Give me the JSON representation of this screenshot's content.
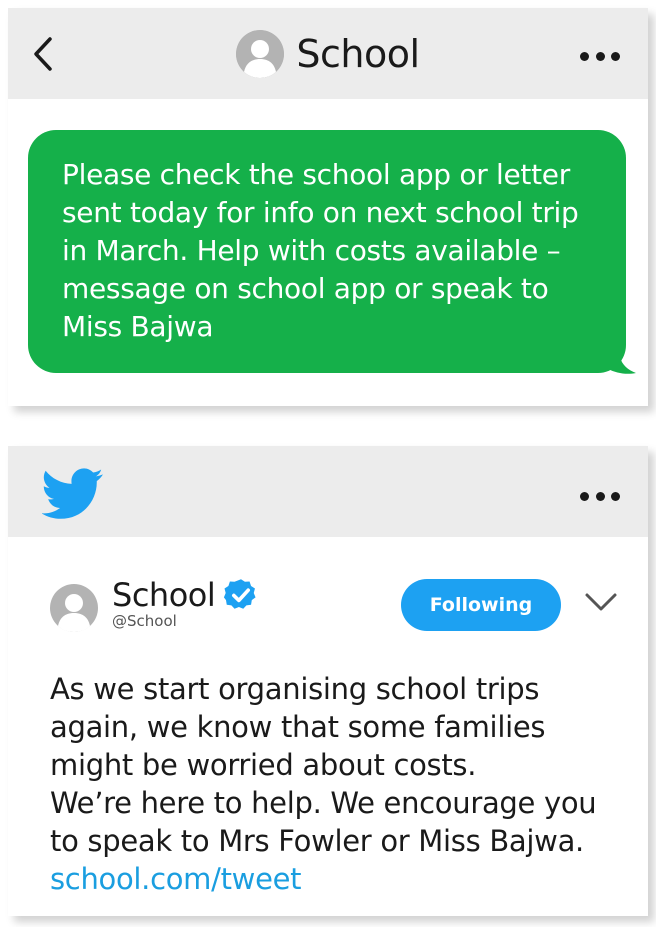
{
  "sms": {
    "contact_name": "School",
    "message": "Please check the school app or letter sent today for info on next school trip in March. Help with costs available – message on school app or speak to Miss Bajwa",
    "colors": {
      "bubble": "#15b04a",
      "header": "#ececec"
    },
    "icons": {
      "back": "chevron-left-icon",
      "avatar": "person-icon",
      "more": "more-dots-icon"
    }
  },
  "twitter": {
    "name": "School",
    "handle": "@School",
    "follow_label": "Following",
    "tweet_lines": [
      "As we start organising school trips",
      "again, we know that some families",
      "might be worried about costs.",
      "We’re here to help. We encourage you",
      "to speak to Mrs Fowler or Miss Bajwa."
    ],
    "link": "school.com/tweet",
    "colors": {
      "brand": "#1da1f2",
      "link": "#1a9ee0",
      "verified": "#1da1f2"
    },
    "icons": {
      "logo": "twitter-bird-icon",
      "verified": "verified-badge-icon",
      "menu": "chevron-down-icon",
      "more": "more-dots-icon"
    }
  }
}
